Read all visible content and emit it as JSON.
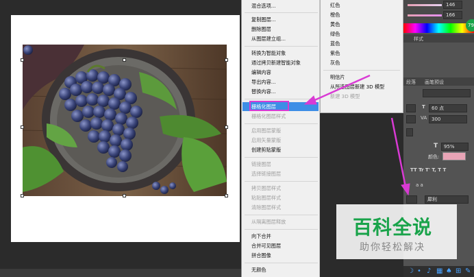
{
  "context_menu": {
    "items": [
      {
        "label": "混合选项...",
        "disabled": false
      },
      {
        "label": "复制图层...",
        "disabled": false
      },
      {
        "label": "删除图层",
        "disabled": false
      },
      {
        "label": "从图层建立组...",
        "disabled": false
      },
      {
        "label": "转换为智能对象",
        "disabled": false
      },
      {
        "label": "通过拷贝新建智能对象",
        "disabled": false
      },
      {
        "label": "编辑内容",
        "disabled": false
      },
      {
        "label": "导出内容...",
        "disabled": false
      },
      {
        "label": "替换内容...",
        "disabled": false
      },
      {
        "label": "栅格化图层",
        "disabled": false,
        "highlighted": true
      },
      {
        "label": "栅格化图层样式",
        "disabled": true
      },
      {
        "label": "启用图层蒙版",
        "disabled": true
      },
      {
        "label": "启用矢量蒙版",
        "disabled": true
      },
      {
        "label": "创建剪贴蒙版",
        "disabled": false
      },
      {
        "label": "链接图层",
        "disabled": true
      },
      {
        "label": "选择链接图层",
        "disabled": true
      },
      {
        "label": "拷贝图层样式",
        "disabled": true
      },
      {
        "label": "粘贴图层样式",
        "disabled": true
      },
      {
        "label": "清除图层样式",
        "disabled": true
      },
      {
        "label": "从隔离图层释放",
        "disabled": true
      },
      {
        "label": "向下合并",
        "disabled": false
      },
      {
        "label": "合并可见图层",
        "disabled": false
      },
      {
        "label": "拼合图像",
        "disabled": false
      },
      {
        "label": "无颜色",
        "disabled": false
      }
    ]
  },
  "submenu": {
    "items": [
      {
        "label": "红色",
        "disabled": false
      },
      {
        "label": "橙色",
        "disabled": false
      },
      {
        "label": "黄色",
        "disabled": false
      },
      {
        "label": "绿色",
        "disabled": false
      },
      {
        "label": "蓝色",
        "disabled": false
      },
      {
        "label": "紫色",
        "disabled": false
      },
      {
        "label": "灰色",
        "disabled": false
      },
      {
        "label": "明信片",
        "disabled": false
      },
      {
        "label": "从所选图层新建 3D 模型",
        "disabled": false
      },
      {
        "label": "新建 3D 模型",
        "disabled": true
      }
    ]
  },
  "panel": {
    "value_1": "146",
    "value_2": "166",
    "badge": "79",
    "tab_style": "样式",
    "tab_paragraph": "段落",
    "tab_preset": "画笔预设",
    "font_size": "60 点",
    "tracking": "300",
    "scale": "95%",
    "color_label": "颜色:",
    "antialias": "犀利",
    "type_buttons": "TT Tr T' T, T T",
    "aa_label": "a a"
  },
  "watermark": {
    "title": "百科全说",
    "subtitle": "助你轻松解决"
  },
  "colors": {
    "highlight": "#3d8ee6",
    "annotation": "#d93ad4",
    "watermark_green": "#19a34a",
    "swatch": "#e8a4b6"
  }
}
